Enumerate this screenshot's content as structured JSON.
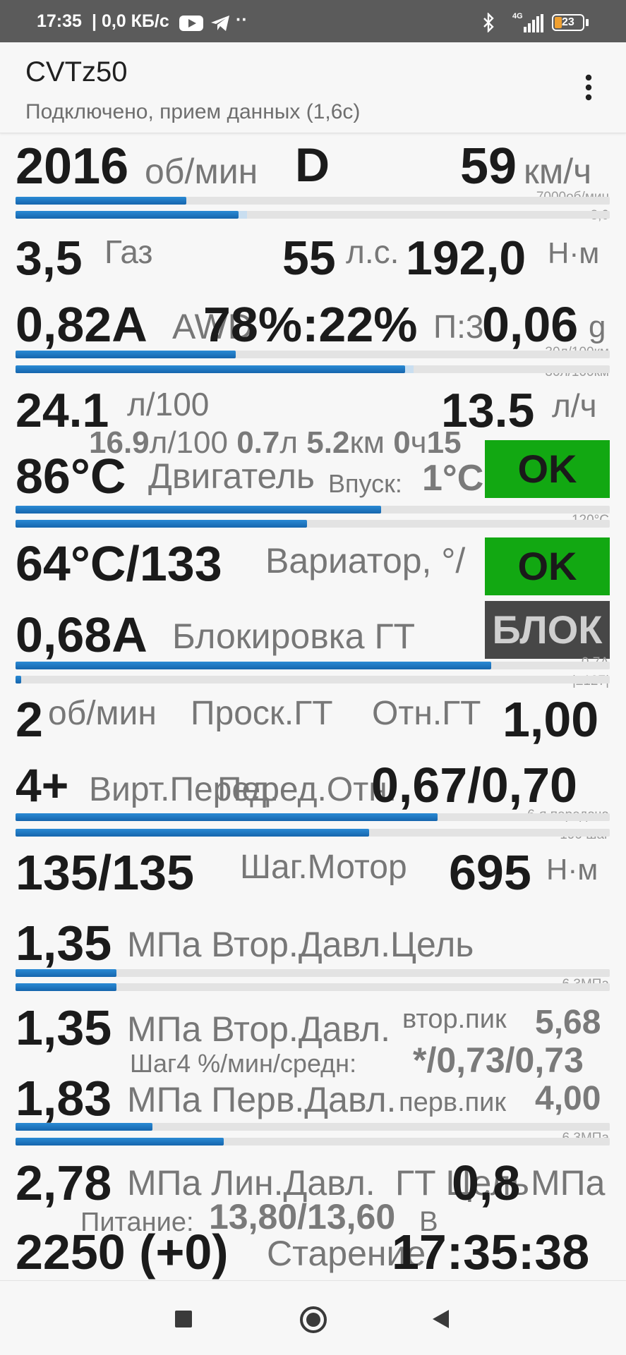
{
  "status_bar": {
    "time": "17:35",
    "speed": "| 0,0 КБ/с",
    "dots": "··",
    "network": "4G",
    "battery": "23"
  },
  "app_bar": {
    "title": "CVTz50",
    "subtitle": "Подключено, прием данных (1,6с)"
  },
  "rows": {
    "rpm": {
      "value": "2016",
      "unit": "об/мин",
      "gear_mode": "D",
      "speed": "59",
      "speed_unit": "км/ч",
      "scale_rpm": "7000об/мин",
      "scale_2": "8,0"
    },
    "power": {
      "gas_value": "3,5",
      "gas_label": "Газ",
      "hp": "55",
      "hp_unit": "л.с.",
      "torque": "192,0",
      "torque_unit": "Н·м"
    },
    "awd": {
      "current": "0,82A",
      "label": "AWD",
      "split": "78%:22%",
      "p_label": "П:3",
      "g_value": "0,06",
      "g_unit": "g",
      "scale_1": "30л/100км",
      "scale_2": "30л/100км"
    },
    "fuel": {
      "consumption": "24.1",
      "consumption_unit": "л/100",
      "hourly": "13.5",
      "hourly_unit": "л/ч",
      "avg": "16.9",
      "avg_unit": "л/100",
      "liters": "0.7",
      "liters_unit": "л",
      "km": "5.2",
      "km_unit": "км",
      "hours": "0",
      "hours_unit": "ч",
      "minutes": "15"
    },
    "engine": {
      "temp": "86°C",
      "label": "Двигатель",
      "intake_label": "Впуск:",
      "intake_value": "1°C",
      "status": "OK",
      "scale": "120°C"
    },
    "cvt": {
      "temp": "64°C/133",
      "label": "Вариатор, °/",
      "status": "OK"
    },
    "lockup": {
      "current": "0,68A",
      "label": "Блокировка ГТ",
      "status": "БЛОК",
      "scale_1": "0,7A",
      "scale_2": "|±127|"
    },
    "slip": {
      "value": "2",
      "unit": "об/мин",
      "label": "Проск.ГТ",
      "ratio_label": "Отн.ГТ",
      "ratio": "1,00"
    },
    "gear": {
      "value": "4+",
      "label_1": "Вирт.Перед.",
      "label_2": "Перед.Отн.",
      "ratio": "0,67/0,70",
      "scale_1": "6-я передача",
      "scale_2": "190 шаг"
    },
    "step": {
      "value": "135/135",
      "label": "Шаг.Мотор",
      "torque": "695",
      "torque_unit": "Н·м"
    },
    "sec_target": {
      "value": "1,35",
      "label": "МПа Втор.Давл.Цель",
      "scale": "6,3МПа"
    },
    "sec": {
      "value": "1,35",
      "label": "МПа Втор.Давл.",
      "peak_label": "втор.пик",
      "peak": "5,68",
      "step_label": "Шаг4 %/мин/средн:",
      "step_values": "*/0,73/0,73"
    },
    "pri": {
      "value": "1,83",
      "label": "МПа Перв.Давл.",
      "peak_label": "перв.пик",
      "peak": "4,00",
      "scale": "6,3МПа"
    },
    "line": {
      "value": "2,78",
      "label": "МПа Лин.Давл.",
      "target_label": "ГТ Цель",
      "target": "0,8",
      "target_unit": "МПа",
      "power_label": "Питание:",
      "power_value": "13,80/13,60",
      "power_unit": "В"
    },
    "aging": {
      "value": "2250 (+0)",
      "label": "Старение",
      "clock": "17:35:38"
    }
  },
  "bars": {
    "rpm": 0.288,
    "speed": 0.375,
    "fuel_a": 0.37,
    "fuel_b": 0.655,
    "engine_a": 0.615,
    "engine_b": 0.49,
    "lockup_a": 0.8,
    "lockup_b": 0.01,
    "gear_a": 0.71,
    "gear_b": 0.595,
    "sec_a": 0.17,
    "sec_b": 0.17,
    "pri_a": 0.23,
    "pri_b": 0.35
  },
  "colors": {
    "ok": "#12a812",
    "block": "#474747",
    "bar": "#1e78c4"
  }
}
